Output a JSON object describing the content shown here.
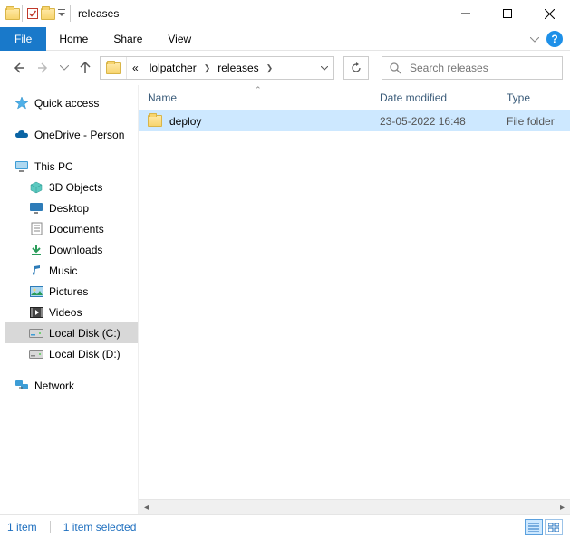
{
  "title": "releases",
  "menubar": {
    "file": "File",
    "home": "Home",
    "share": "Share",
    "view": "View"
  },
  "address": {
    "chevrons_label": "«",
    "segments": [
      "lolpatcher",
      "releases"
    ]
  },
  "search": {
    "placeholder": "Search releases"
  },
  "tree": {
    "quick_access": "Quick access",
    "onedrive": "OneDrive - Person",
    "this_pc": "This PC",
    "objects3d": "3D Objects",
    "desktop": "Desktop",
    "documents": "Documents",
    "downloads": "Downloads",
    "music": "Music",
    "pictures": "Pictures",
    "videos": "Videos",
    "local_c": "Local Disk (C:)",
    "local_d": "Local Disk (D:)",
    "network": "Network"
  },
  "columns": {
    "name": "Name",
    "date": "Date modified",
    "type": "Type"
  },
  "rows": [
    {
      "name": "deploy",
      "date": "23-05-2022 16:48",
      "type": "File folder"
    }
  ],
  "status": {
    "count": "1 item",
    "selected": "1 item selected"
  }
}
